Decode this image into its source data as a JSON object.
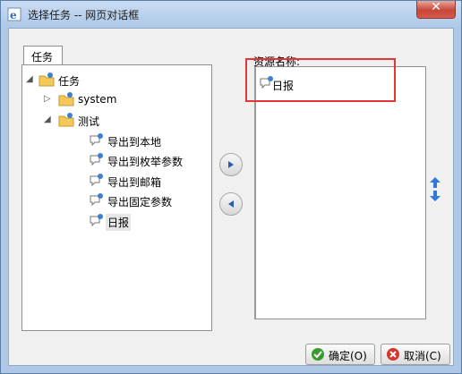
{
  "window": {
    "title": "选择任务 -- 网页对话框",
    "close_label": "✕"
  },
  "tab": {
    "label": "任务"
  },
  "tree": [
    {
      "label": "任务",
      "level": 0,
      "expanded": true,
      "kind": "folder"
    },
    {
      "label": "system",
      "level": 1,
      "expanded": false,
      "kind": "folder"
    },
    {
      "label": "测试",
      "level": 1,
      "expanded": true,
      "kind": "folder"
    },
    {
      "label": "导出到本地",
      "level": 2,
      "kind": "task"
    },
    {
      "label": "导出到枚举参数",
      "level": 2,
      "kind": "task"
    },
    {
      "label": "导出到邮箱",
      "level": 2,
      "kind": "task"
    },
    {
      "label": "导出固定参数",
      "level": 2,
      "kind": "task"
    },
    {
      "label": "日报",
      "level": 2,
      "kind": "task",
      "selected": true
    }
  ],
  "resource": {
    "label": "资源名称:",
    "items": [
      {
        "label": "日报"
      }
    ]
  },
  "buttons": {
    "ok": "确定(O)",
    "cancel": "取消(C)"
  },
  "colors": {
    "highlight": "#e53535",
    "move_arrow": "#2a5db0",
    "ok_icon": "#3a9a2e",
    "cancel_icon": "#d8332d"
  }
}
